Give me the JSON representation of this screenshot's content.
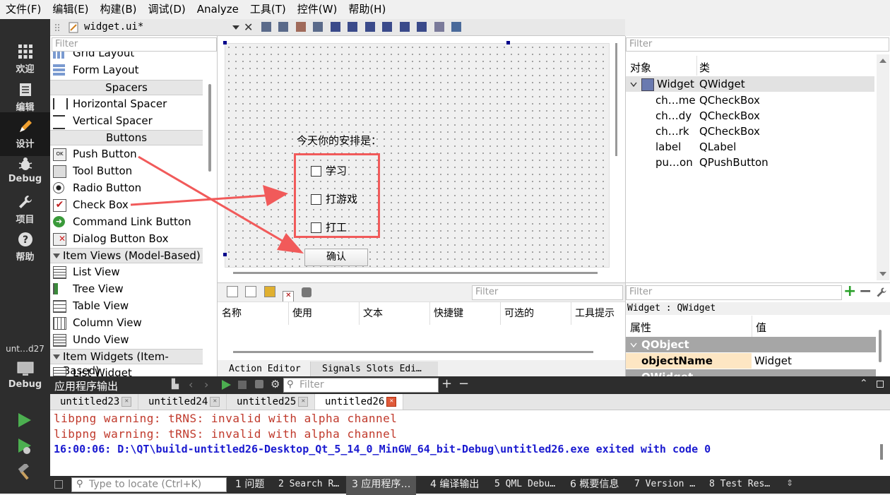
{
  "menubar": [
    "文件(F)",
    "编辑(E)",
    "构建(B)",
    "调试(D)",
    "Analyze",
    "工具(T)",
    "控件(W)",
    "帮助(H)"
  ],
  "sidebar": {
    "modes": [
      {
        "label": "欢迎",
        "icon": "grid-icon"
      },
      {
        "label": "编辑",
        "icon": "document-icon"
      },
      {
        "label": "设计",
        "icon": "pencil-icon"
      },
      {
        "label": "Debug",
        "icon": "bug-icon"
      },
      {
        "label": "项目",
        "icon": "wrench-icon"
      },
      {
        "label": "帮助",
        "icon": "help-icon"
      }
    ],
    "project_label": "unt…d27",
    "kit_label": "Debug"
  },
  "editor_tab": {
    "filename": "widget.ui*"
  },
  "widget_box": {
    "filter_placeholder": "Filter",
    "items_top": [
      "Grid Layout",
      "Form Layout"
    ],
    "cat_spacers": "Spacers",
    "spacers": [
      "Horizontal Spacer",
      "Vertical Spacer"
    ],
    "cat_buttons": "Buttons",
    "buttons": [
      "Push Button",
      "Tool Button",
      "Radio Button",
      "Check Box",
      "Command Link Button",
      "Dialog Button Box"
    ],
    "cat_item_views": "Item Views (Model-Based)",
    "item_views": [
      "List View",
      "Tree View",
      "Table View",
      "Column View",
      "Undo View"
    ],
    "cat_item_widgets": "Item Widgets (Item-Based)",
    "item_widgets": [
      "List Widget"
    ]
  },
  "form": {
    "label": "今天你的安排是：",
    "checkboxes": [
      "学习",
      "打游戏",
      "打工"
    ],
    "confirm_button": "确认"
  },
  "action_editor": {
    "filter_placeholder": "Filter",
    "columns": [
      "名称",
      "使用",
      "文本",
      "快捷键",
      "可选的",
      "工具提示"
    ],
    "tabs": [
      "Action Editor",
      "Signals  Slots Edi…"
    ]
  },
  "object_inspector": {
    "filter_placeholder": "Filter",
    "col_object": "对象",
    "col_class": "类",
    "root": {
      "name": "Widget",
      "class": "QWidget"
    },
    "children": [
      {
        "name": "ch…me",
        "class": "QCheckBox"
      },
      {
        "name": "ch…dy",
        "class": "QCheckBox"
      },
      {
        "name": "ch…rk",
        "class": "QCheckBox"
      },
      {
        "name": "label",
        "class": "QLabel"
      },
      {
        "name": "pu…on",
        "class": "QPushButton"
      }
    ]
  },
  "property_editor": {
    "filter_placeholder": "Filter",
    "context": "Widget : QWidget",
    "col_property": "属性",
    "col_value": "值",
    "section": "QObject",
    "section2": "QWidget",
    "prop_name": "objectName",
    "prop_value": "Widget"
  },
  "output": {
    "title": "应用程序输出",
    "filter_placeholder": "Filter",
    "tabs": [
      "untitled23",
      "untitled24",
      "untitled25",
      "untitled26"
    ],
    "lines": [
      "libpng warning: tRNS: invalid with alpha channel",
      "libpng warning: tRNS: invalid with alpha channel",
      "16:00:06: D:\\QT\\build-untitled26-Desktop_Qt_5_14_0_MinGW_64_bit-Debug\\untitled26.exe exited with code 0"
    ]
  },
  "statusbar": {
    "locate_placeholder": "Type to locate (Ctrl+K)",
    "items": [
      "1 问题",
      "2 Search R…",
      "3 应用程序…",
      "4 编译输出",
      "5 QML Debu…",
      "6 概要信息",
      "7 Version …",
      "8 Test Res…"
    ]
  },
  "colors": {
    "sidebar": "#2d2d2d",
    "warning_text": "#c0392b",
    "exit_text": "#1a1ad0",
    "annotation": "#f15a5a"
  }
}
